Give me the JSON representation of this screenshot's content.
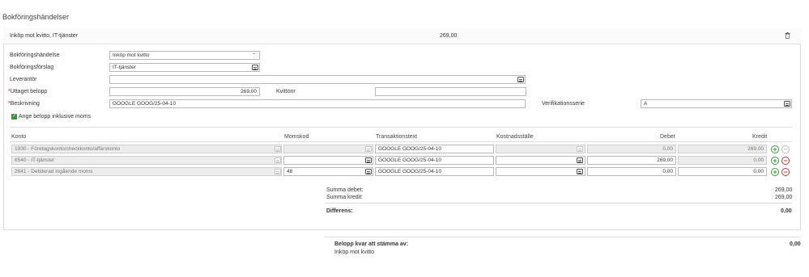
{
  "page_title": "Bokföringshändelser",
  "event": {
    "title": "Inköp mot kvitto, IT-tjänster",
    "amount": "269,00"
  },
  "form": {
    "bokforingshandelse": {
      "label": "Bokföringshändelse",
      "value": "Inköp mot kvitto"
    },
    "bokforingsforslag": {
      "label": "Bokföringsförslag",
      "value": "IT-tjänster"
    },
    "leverantor": {
      "label": "Leverantör",
      "value": ""
    },
    "uttaget_belopp": {
      "required_mark": "*",
      "label": "Uttaget belopp",
      "value": "269,00"
    },
    "kvittonr": {
      "label": "Kvittonr",
      "value": ""
    },
    "beskrivning": {
      "required_mark": "*",
      "label": "Beskrivning",
      "value": "GOOGLE  GOOG/25-04-10"
    },
    "verifikationsserie": {
      "label": "Verifikationsserie",
      "value": "A"
    },
    "inklusive_moms": {
      "label": "Ange belopp inklusive moms",
      "checked": true
    }
  },
  "table": {
    "headers": {
      "konto": "Konto",
      "momskod": "Momskod",
      "transaktionstext": "Transaktionstext",
      "kostnadsstalle": "Kostnadsställe",
      "debet": "Debet",
      "kredit": "Kredit"
    },
    "rows": [
      {
        "konto": "1930 - Företagskonto/checkkonto/affärskonto",
        "momskod": "",
        "transaktionstext": "GOOGLE  GOOG/25-04-10",
        "kostnadsstalle": "",
        "debet": "0,00",
        "kredit": "269,00"
      },
      {
        "konto": "6540 - IT-tjänster",
        "momskod": "",
        "transaktionstext": "GOOGLE  GOOG/25-04-10",
        "kostnadsstalle": "",
        "debet": "269,00",
        "kredit": "0,00"
      },
      {
        "konto": "2641 - Debiterad ingående moms",
        "momskod": "48",
        "transaktionstext": "GOOGLE  GOOG/25-04-10",
        "kostnadsstalle": "",
        "debet": "0,00",
        "kredit": "0,00"
      }
    ]
  },
  "summary": {
    "summa_debet": {
      "label": "Summa debet:",
      "value": "269,00"
    },
    "summa_kredit": {
      "label": "Summa kredit:",
      "value": "269,00"
    },
    "differens": {
      "label": "Differens:",
      "value": "0,00"
    }
  },
  "footer": {
    "belopp_kvar": {
      "label": "Belopp kvar att stämma av:",
      "value": "0,00"
    },
    "subtitle": "Inköp mot kvitto"
  },
  "icons": {
    "plus": "+",
    "minus": "−",
    "check": "✓",
    "chevron": "⌄"
  },
  "colors": {
    "plus": "#3a9b3a",
    "minus": "#c23a3a",
    "checkbox": "#3a8f3a"
  }
}
